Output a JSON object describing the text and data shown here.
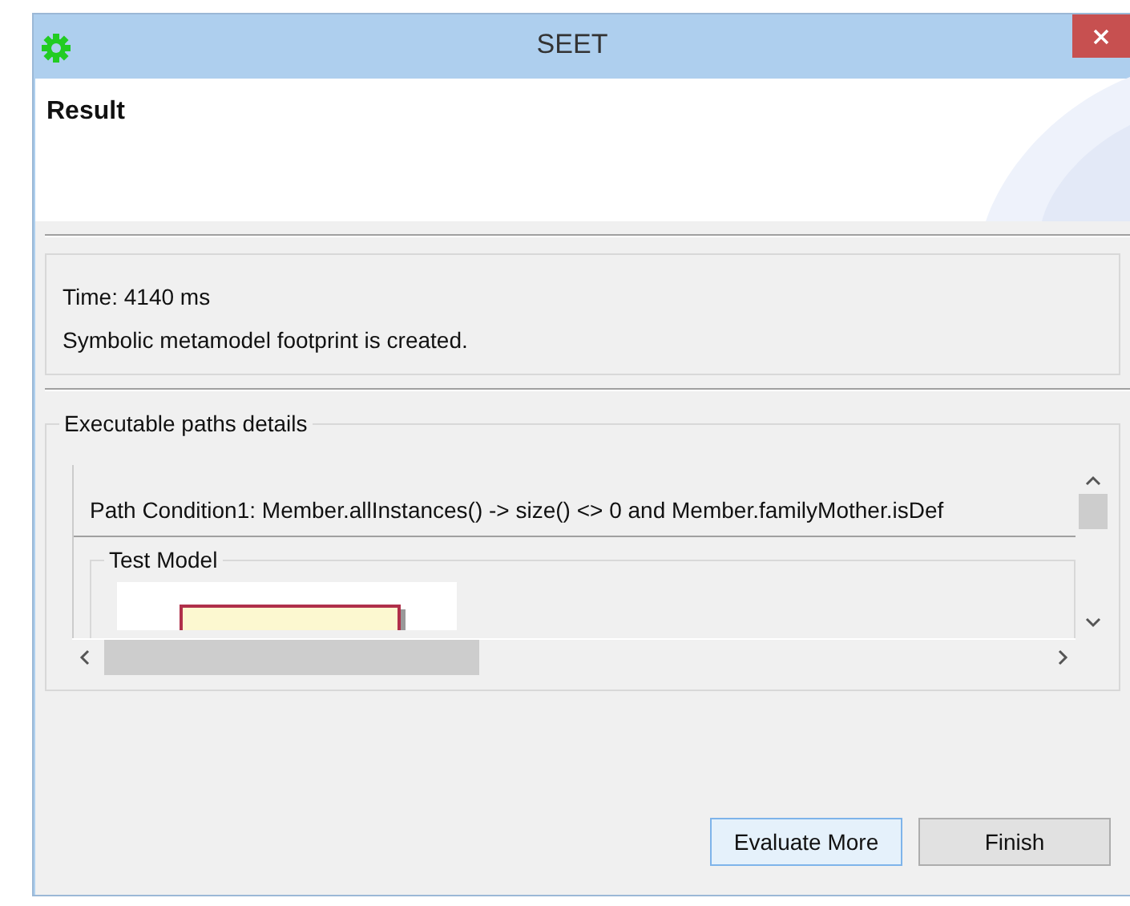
{
  "window": {
    "title": "SEET"
  },
  "header": {
    "title": "Result"
  },
  "messages": [
    "Time: 4140 ms",
    "Symbolic metamodel footprint is created."
  ],
  "details": {
    "legend": "Executable paths details",
    "path_condition": "Path Condition1: Member.allInstances() -> size() <> 0 and Member.familyMother.isDef",
    "test_model": {
      "legend": "Test Model"
    }
  },
  "buttons": [
    {
      "label": "Evaluate More",
      "selected": true
    },
    {
      "label": "Finish",
      "selected": false
    }
  ]
}
